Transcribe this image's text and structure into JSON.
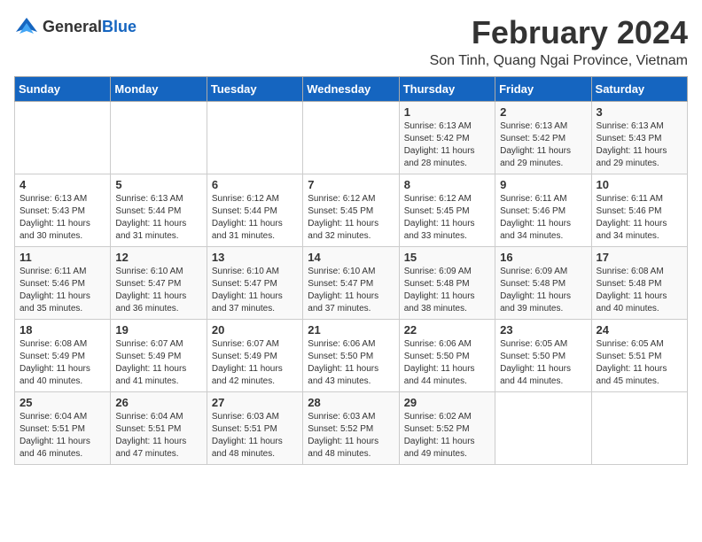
{
  "header": {
    "logo_general": "General",
    "logo_blue": "Blue",
    "title": "February 2024",
    "subtitle": "Son Tinh, Quang Ngai Province, Vietnam"
  },
  "weekdays": [
    "Sunday",
    "Monday",
    "Tuesday",
    "Wednesday",
    "Thursday",
    "Friday",
    "Saturday"
  ],
  "weeks": [
    [
      {
        "day": "",
        "sunrise": "",
        "sunset": "",
        "daylight": ""
      },
      {
        "day": "",
        "sunrise": "",
        "sunset": "",
        "daylight": ""
      },
      {
        "day": "",
        "sunrise": "",
        "sunset": "",
        "daylight": ""
      },
      {
        "day": "",
        "sunrise": "",
        "sunset": "",
        "daylight": ""
      },
      {
        "day": "1",
        "sunrise": "Sunrise: 6:13 AM",
        "sunset": "Sunset: 5:42 PM",
        "daylight": "Daylight: 11 hours and 28 minutes."
      },
      {
        "day": "2",
        "sunrise": "Sunrise: 6:13 AM",
        "sunset": "Sunset: 5:42 PM",
        "daylight": "Daylight: 11 hours and 29 minutes."
      },
      {
        "day": "3",
        "sunrise": "Sunrise: 6:13 AM",
        "sunset": "Sunset: 5:43 PM",
        "daylight": "Daylight: 11 hours and 29 minutes."
      }
    ],
    [
      {
        "day": "4",
        "sunrise": "Sunrise: 6:13 AM",
        "sunset": "Sunset: 5:43 PM",
        "daylight": "Daylight: 11 hours and 30 minutes."
      },
      {
        "day": "5",
        "sunrise": "Sunrise: 6:13 AM",
        "sunset": "Sunset: 5:44 PM",
        "daylight": "Daylight: 11 hours and 31 minutes."
      },
      {
        "day": "6",
        "sunrise": "Sunrise: 6:12 AM",
        "sunset": "Sunset: 5:44 PM",
        "daylight": "Daylight: 11 hours and 31 minutes."
      },
      {
        "day": "7",
        "sunrise": "Sunrise: 6:12 AM",
        "sunset": "Sunset: 5:45 PM",
        "daylight": "Daylight: 11 hours and 32 minutes."
      },
      {
        "day": "8",
        "sunrise": "Sunrise: 6:12 AM",
        "sunset": "Sunset: 5:45 PM",
        "daylight": "Daylight: 11 hours and 33 minutes."
      },
      {
        "day": "9",
        "sunrise": "Sunrise: 6:11 AM",
        "sunset": "Sunset: 5:46 PM",
        "daylight": "Daylight: 11 hours and 34 minutes."
      },
      {
        "day": "10",
        "sunrise": "Sunrise: 6:11 AM",
        "sunset": "Sunset: 5:46 PM",
        "daylight": "Daylight: 11 hours and 34 minutes."
      }
    ],
    [
      {
        "day": "11",
        "sunrise": "Sunrise: 6:11 AM",
        "sunset": "Sunset: 5:46 PM",
        "daylight": "Daylight: 11 hours and 35 minutes."
      },
      {
        "day": "12",
        "sunrise": "Sunrise: 6:10 AM",
        "sunset": "Sunset: 5:47 PM",
        "daylight": "Daylight: 11 hours and 36 minutes."
      },
      {
        "day": "13",
        "sunrise": "Sunrise: 6:10 AM",
        "sunset": "Sunset: 5:47 PM",
        "daylight": "Daylight: 11 hours and 37 minutes."
      },
      {
        "day": "14",
        "sunrise": "Sunrise: 6:10 AM",
        "sunset": "Sunset: 5:47 PM",
        "daylight": "Daylight: 11 hours and 37 minutes."
      },
      {
        "day": "15",
        "sunrise": "Sunrise: 6:09 AM",
        "sunset": "Sunset: 5:48 PM",
        "daylight": "Daylight: 11 hours and 38 minutes."
      },
      {
        "day": "16",
        "sunrise": "Sunrise: 6:09 AM",
        "sunset": "Sunset: 5:48 PM",
        "daylight": "Daylight: 11 hours and 39 minutes."
      },
      {
        "day": "17",
        "sunrise": "Sunrise: 6:08 AM",
        "sunset": "Sunset: 5:48 PM",
        "daylight": "Daylight: 11 hours and 40 minutes."
      }
    ],
    [
      {
        "day": "18",
        "sunrise": "Sunrise: 6:08 AM",
        "sunset": "Sunset: 5:49 PM",
        "daylight": "Daylight: 11 hours and 40 minutes."
      },
      {
        "day": "19",
        "sunrise": "Sunrise: 6:07 AM",
        "sunset": "Sunset: 5:49 PM",
        "daylight": "Daylight: 11 hours and 41 minutes."
      },
      {
        "day": "20",
        "sunrise": "Sunrise: 6:07 AM",
        "sunset": "Sunset: 5:49 PM",
        "daylight": "Daylight: 11 hours and 42 minutes."
      },
      {
        "day": "21",
        "sunrise": "Sunrise: 6:06 AM",
        "sunset": "Sunset: 5:50 PM",
        "daylight": "Daylight: 11 hours and 43 minutes."
      },
      {
        "day": "22",
        "sunrise": "Sunrise: 6:06 AM",
        "sunset": "Sunset: 5:50 PM",
        "daylight": "Daylight: 11 hours and 44 minutes."
      },
      {
        "day": "23",
        "sunrise": "Sunrise: 6:05 AM",
        "sunset": "Sunset: 5:50 PM",
        "daylight": "Daylight: 11 hours and 44 minutes."
      },
      {
        "day": "24",
        "sunrise": "Sunrise: 6:05 AM",
        "sunset": "Sunset: 5:51 PM",
        "daylight": "Daylight: 11 hours and 45 minutes."
      }
    ],
    [
      {
        "day": "25",
        "sunrise": "Sunrise: 6:04 AM",
        "sunset": "Sunset: 5:51 PM",
        "daylight": "Daylight: 11 hours and 46 minutes."
      },
      {
        "day": "26",
        "sunrise": "Sunrise: 6:04 AM",
        "sunset": "Sunset: 5:51 PM",
        "daylight": "Daylight: 11 hours and 47 minutes."
      },
      {
        "day": "27",
        "sunrise": "Sunrise: 6:03 AM",
        "sunset": "Sunset: 5:51 PM",
        "daylight": "Daylight: 11 hours and 48 minutes."
      },
      {
        "day": "28",
        "sunrise": "Sunrise: 6:03 AM",
        "sunset": "Sunset: 5:52 PM",
        "daylight": "Daylight: 11 hours and 48 minutes."
      },
      {
        "day": "29",
        "sunrise": "Sunrise: 6:02 AM",
        "sunset": "Sunset: 5:52 PM",
        "daylight": "Daylight: 11 hours and 49 minutes."
      },
      {
        "day": "",
        "sunrise": "",
        "sunset": "",
        "daylight": ""
      },
      {
        "day": "",
        "sunrise": "",
        "sunset": "",
        "daylight": ""
      }
    ]
  ]
}
